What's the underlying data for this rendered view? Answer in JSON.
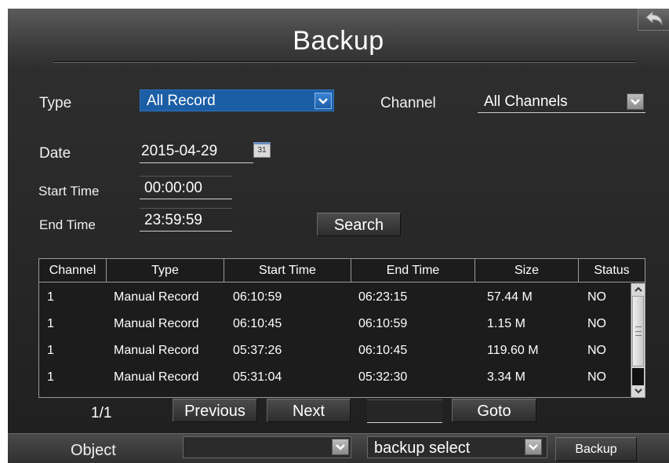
{
  "header": {
    "title": "Backup",
    "back_icon": "back-arrow-icon"
  },
  "filters": {
    "type_label": "Type",
    "type_value": "All Record",
    "channel_label": "Channel",
    "channel_value": "All Channels",
    "date_label": "Date",
    "date_value": "2015-04-29",
    "calendar_icon_text": "31",
    "start_time_label": "Start Time",
    "start_time_value": "00:00:00",
    "end_time_label": "End Time",
    "end_time_value": "23:59:59",
    "search_label": "Search"
  },
  "table": {
    "columns": [
      "Channel",
      "Type",
      "Start Time",
      "End Time",
      "Size",
      "Status"
    ],
    "rows": [
      [
        "1",
        "Manual Record",
        "06:10:59",
        "06:23:15",
        "57.44 M",
        "NO"
      ],
      [
        "1",
        "Manual Record",
        "06:10:45",
        "06:10:59",
        "1.15 M",
        "NO"
      ],
      [
        "1",
        "Manual Record",
        "05:37:26",
        "06:10:45",
        "119.60 M",
        "NO"
      ],
      [
        "1",
        "Manual Record",
        "05:31:04",
        "05:32:30",
        "3.34 M",
        "NO"
      ]
    ]
  },
  "pager": {
    "page_indicator": "1/1",
    "previous_label": "Previous",
    "next_label": "Next",
    "goto_value": "",
    "goto_label": "Goto"
  },
  "footer": {
    "object_label": "Object",
    "object_value": "",
    "backup_select_value": "backup select",
    "backup_label": "Backup"
  },
  "colors": {
    "selected_blue": "#1b5ea6",
    "panel_dark": "#1f1f1f"
  }
}
